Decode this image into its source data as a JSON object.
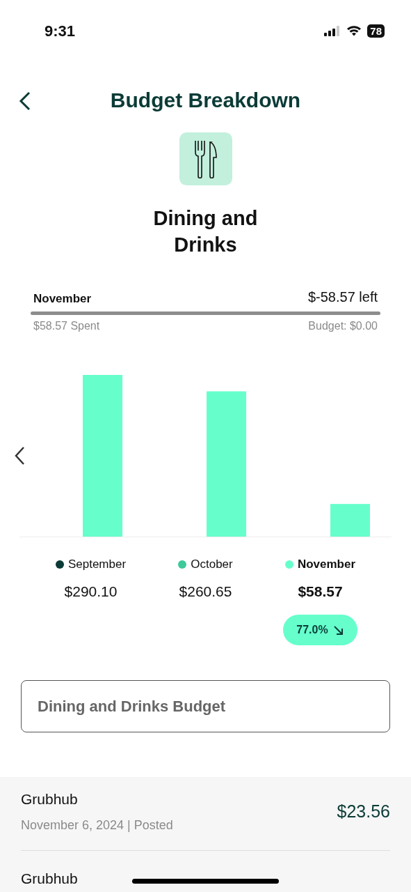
{
  "status_bar": {
    "time": "9:31",
    "battery": "78"
  },
  "header": {
    "title": "Budget Breakdown"
  },
  "category": {
    "title": "Dining and\nDrinks"
  },
  "budget": {
    "month": "November",
    "left": "$-58.57 left",
    "level": 1,
    "spent": "$58.57 Spent",
    "budget": "Budget: $0.00"
  },
  "chart_data": {
    "type": "bar",
    "categories": [
      "September",
      "October",
      "November"
    ],
    "values": [
      290.1,
      260.65,
      58.57
    ],
    "value_labels": [
      "$290.10",
      "$260.65",
      "$58.57"
    ]
  },
  "months": [
    {
      "color": "#0b3b36",
      "selected": false
    },
    {
      "color": "#3ec99a",
      "selected": false
    },
    {
      "color": "#66ffcc",
      "selected": true
    }
  ],
  "change": {
    "text": "77.0%"
  },
  "budget_button": "Dining and Drinks Budget",
  "transactions": [
    {
      "merchant": "Grubhub",
      "detail": "November 6, 2024 | Posted",
      "amount": "$23.56"
    },
    {
      "merchant": "Grubhub"
    }
  ]
}
